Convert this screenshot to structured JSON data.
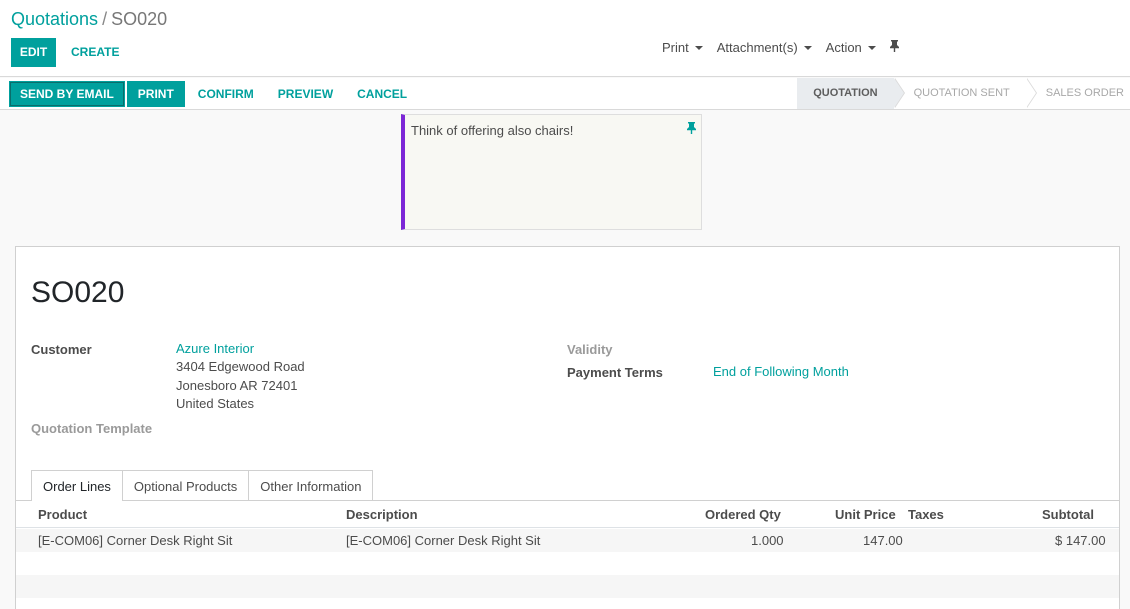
{
  "breadcrumb": {
    "parent": "Quotations",
    "separator": "/",
    "current": "SO020"
  },
  "control": {
    "edit_label": "EDIT",
    "create_label": "CREATE"
  },
  "sidebar": {
    "print": "Print",
    "attachments": "Attachment(s)",
    "action": "Action"
  },
  "statusbar": {
    "buttons": [
      "SEND BY EMAIL",
      "PRINT",
      "CONFIRM",
      "PREVIEW",
      "CANCEL"
    ],
    "stages": [
      "QUOTATION",
      "QUOTATION SENT",
      "SALES ORDER"
    ],
    "active_stage": "QUOTATION"
  },
  "note": {
    "text": "Think of offering also chairs!",
    "accent_color": "#7c27d6"
  },
  "form": {
    "title": "SO020",
    "customer_label": "Customer",
    "customer_name": "Azure Interior",
    "address_line1": "3404 Edgewood Road",
    "address_line2": "Jonesboro AR 72401",
    "address_line3": "United States",
    "quotation_template_label": "Quotation Template",
    "validity_label": "Validity",
    "payment_terms_label": "Payment Terms",
    "payment_terms_value": "End of Following Month"
  },
  "tabs": [
    "Order Lines",
    "Optional Products",
    "Other Information"
  ],
  "order_lines": {
    "columns": [
      "Product",
      "Description",
      "Ordered Qty",
      "Unit Price",
      "Taxes",
      "Subtotal"
    ],
    "rows": [
      {
        "product": "[E-COM06] Corner Desk Right Sit",
        "description": "[E-COM06] Corner Desk Right Sit",
        "qty": "1.000",
        "unit_price": "147.00",
        "taxes": "",
        "subtotal": "$ 147.00"
      }
    ]
  },
  "colors": {
    "brand": "#00a09d",
    "note_accent": "#7c27d6"
  }
}
